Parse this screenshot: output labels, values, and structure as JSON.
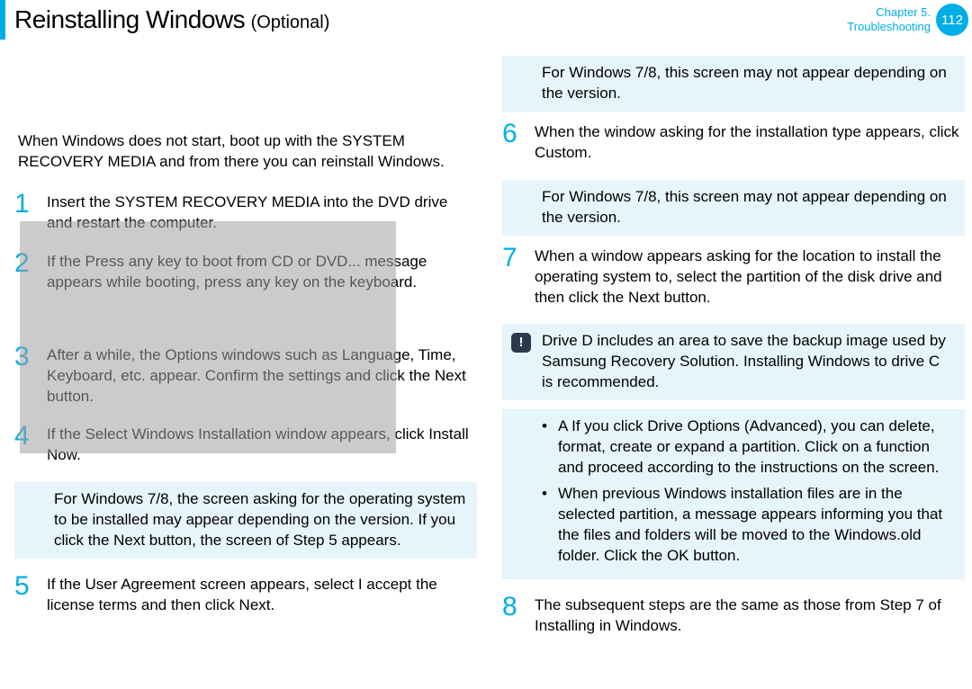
{
  "header": {
    "title": "Reinstalling Windows",
    "subtitle": "(Optional)",
    "chapter_line1": "Chapter 5.",
    "chapter_line2": "Troubleshooting",
    "page_number": "112"
  },
  "intro": "When Windows does not start, boot up with the SYSTEM RECOVERY MEDIA and from there you can reinstall Windows.",
  "steps": {
    "s1": "Insert the SYSTEM RECOVERY MEDIA into the DVD drive and restart the computer.",
    "s2": "If the Press any key to boot from CD or DVD... message appears while booting, press any key on the keyboard.",
    "s3": "After a while, the Options windows such as Language, Time, Keyboard, etc. appear. Conﬁrm the settings and click the Next button.",
    "s4": "If the Select Windows Installation window appears, click Install Now.",
    "s5": "If the User Agreement screen appears, select I accept the license terms and then click Next.",
    "s6": "When the window asking for the installation type appears, click Custom.",
    "s7": "When a window appears asking for the location to install the operating system to, select the partition of the disk drive and then click the Next button.",
    "s8": "The subsequent steps are the same as those from Step 7 of Installing in Windows."
  },
  "notes": {
    "n4": "For Windows 7/8, the screen asking for the operating system to be installed may appear depending on the version. If you click the Next button, the screen of Step 5 appears.",
    "n5": "For Windows 7/8, this screen may not appear depending on the version.",
    "n6": "For Windows 7/8, this screen may not appear depending on the version.",
    "n7warn": "Drive D includes an area to save the backup image used by Samsung Recovery Solution. Installing Windows to drive C is recommended.",
    "n7b1": "A If you click Drive Options (Advanced), you can delete, format, create or expand a partition. Click on a function and proceed according to the instructions on the screen.",
    "n7b2": "When previous Windows installation ﬁles are in the selected partition, a message appears informing you that the ﬁles and folders will be moved to the Windows.old folder. Click the OK button."
  },
  "nums": {
    "n1": "1",
    "n2": "2",
    "n3": "3",
    "n4": "4",
    "n5": "5",
    "n6": "6",
    "n7": "7",
    "n8": "8"
  },
  "icons": {
    "warn": "!",
    "bullet": "•"
  }
}
